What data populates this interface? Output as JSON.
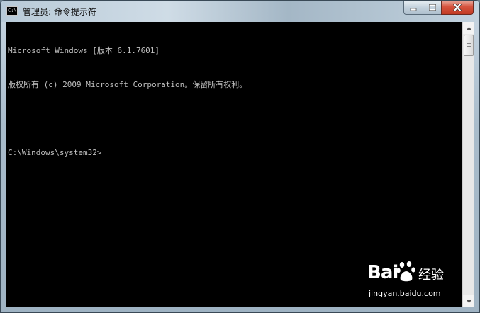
{
  "window": {
    "title": "管理员: 命令提示符",
    "icon": "cmd-icon",
    "icon_text": "C:\\"
  },
  "caption_buttons": {
    "minimize": "minimize-icon",
    "maximize": "maximize-icon",
    "close": "close-icon"
  },
  "console": {
    "lines": [
      "Microsoft Windows [版本 6.1.7601]",
      "版权所有 (c) 2009 Microsoft Corporation。保留所有权利。",
      "",
      "C:\\Windows\\system32>"
    ],
    "background": "#000000",
    "foreground": "#c0c0c0"
  },
  "watermark": {
    "logo": "Bai",
    "brand": "经验",
    "url": "jingyan.baidu.com"
  }
}
